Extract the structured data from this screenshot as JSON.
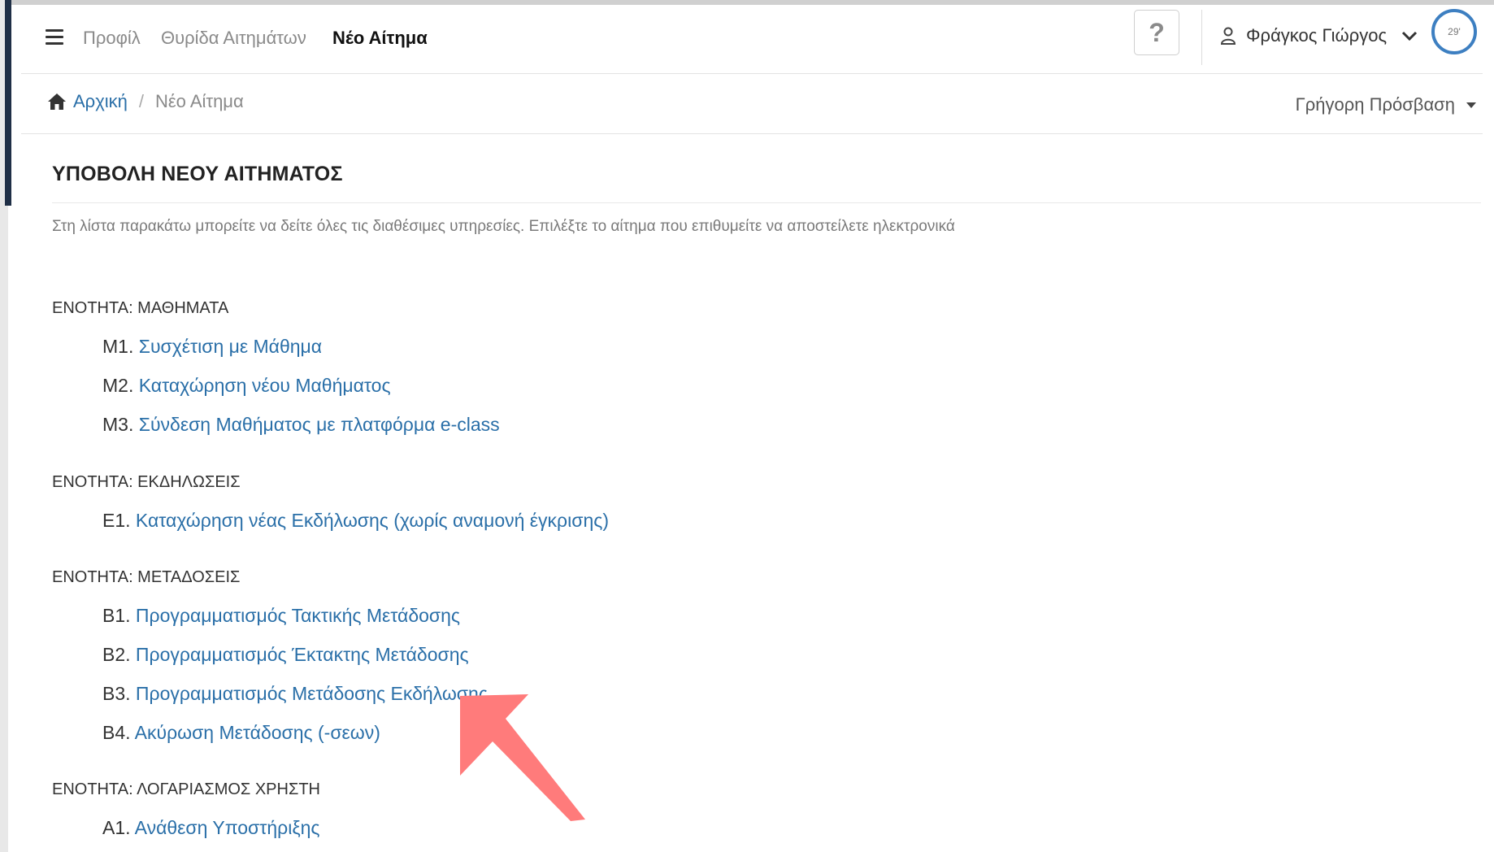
{
  "nav": {
    "links": [
      "Προφίλ",
      "Θυρίδα Αιτημάτων",
      "Νέο Αίτημα"
    ],
    "help_label": "?",
    "user_name": "Φράγκος Γιώργος",
    "timer": "29'"
  },
  "breadcrumb": {
    "home": "Αρχική",
    "separator": "/",
    "current": "Νέο Αίτημα",
    "quick_access": "Γρήγορη Πρόσβαση"
  },
  "page": {
    "title": "ΥΠΟΒΟΛΗ ΝΕΟΥ ΑΙΤΗΜΑΤΟΣ",
    "intro": "Στη λίστα παρακάτω μπορείτε να δείτε όλες τις διαθέσιμες υπηρεσίες. Επιλέξτε το αίτημα που επιθυμείτε να αποστείλετε ηλεκτρονικά"
  },
  "sections": [
    {
      "title": "ΕΝΟΤΗΤΑ: ΜΑΘΗΜΑΤΑ",
      "items": [
        {
          "code": "Μ1.",
          "label": "Συσχέτιση με Μάθημα"
        },
        {
          "code": "Μ2.",
          "label": "Καταχώρηση νέου Μαθήματος"
        },
        {
          "code": "Μ3.",
          "label": "Σύνδεση Μαθήματος με πλατφόρμα e-class"
        }
      ]
    },
    {
      "title": "ΕΝΟΤΗΤΑ: ΕΚΔΗΛΩΣΕΙΣ",
      "items": [
        {
          "code": "Ε1.",
          "label": "Καταχώρηση νέας Εκδήλωσης (χωρίς αναμονή έγκρισης)"
        }
      ]
    },
    {
      "title": "ΕΝΟΤΗΤΑ: ΜΕΤΑΔΟΣΕΙΣ",
      "items": [
        {
          "code": "Β1.",
          "label": "Προγραμματισμός Τακτικής Μετάδοσης"
        },
        {
          "code": "Β2.",
          "label": "Προγραμματισμός Έκτακτης Μετάδοσης"
        },
        {
          "code": "Β3.",
          "label": "Προγραμματισμός Μετάδοσης Εκδήλωσης"
        },
        {
          "code": "Β4.",
          "label": "Ακύρωση Μετάδοσης (-σεων)"
        }
      ]
    },
    {
      "title": "ΕΝΟΤΗΤΑ: ΛΟΓΑΡΙΑΣΜΟΣ ΧΡΗΣΤΗ",
      "items": [
        {
          "code": "Α1.",
          "label": "Ανάθεση Υποστήριξης"
        }
      ]
    }
  ],
  "colors": {
    "link": "#2a6fa8",
    "annotation_arrow": "#ff7b7b",
    "timer_ring": "#3d7fc1"
  }
}
